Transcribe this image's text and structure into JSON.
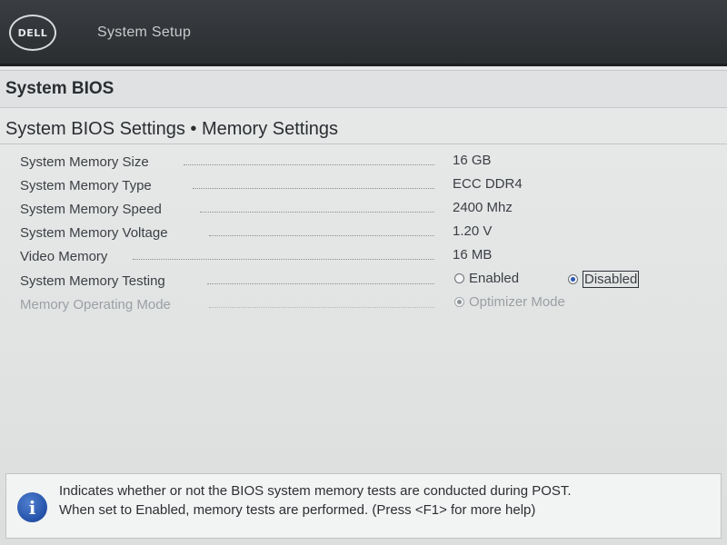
{
  "header": {
    "logo_text": "DELL",
    "app_title": "System Setup"
  },
  "section": {
    "title": "System BIOS"
  },
  "page": {
    "heading": "System BIOS Settings • Memory Settings"
  },
  "settings": [
    {
      "label": "System Memory Size",
      "value": "16 GB"
    },
    {
      "label": "System Memory Type",
      "value": "ECC DDR4"
    },
    {
      "label": "System Memory Speed",
      "value": "2400 Mhz"
    },
    {
      "label": "System Memory Voltage",
      "value": "1.20 V"
    },
    {
      "label": "Video Memory",
      "value": "16 MB"
    },
    {
      "label": "System Memory Testing",
      "options": [
        {
          "label": "Enabled",
          "selected": false
        },
        {
          "label": "Disabled",
          "selected": true
        }
      ]
    },
    {
      "label": "Memory Operating Mode",
      "disabled": true,
      "options": [
        {
          "label": "Optimizer Mode",
          "selected": true
        }
      ]
    }
  ],
  "help": {
    "icon": "info-icon",
    "line1": "Indicates whether or not the BIOS system memory tests are conducted during POST.",
    "line2": "When set to Enabled, memory tests are performed. (Press <F1> for more help)"
  },
  "colors": {
    "header_bg": "#2b2e31",
    "accent_blue": "#2c57b8",
    "background": "#e4e6e6"
  }
}
